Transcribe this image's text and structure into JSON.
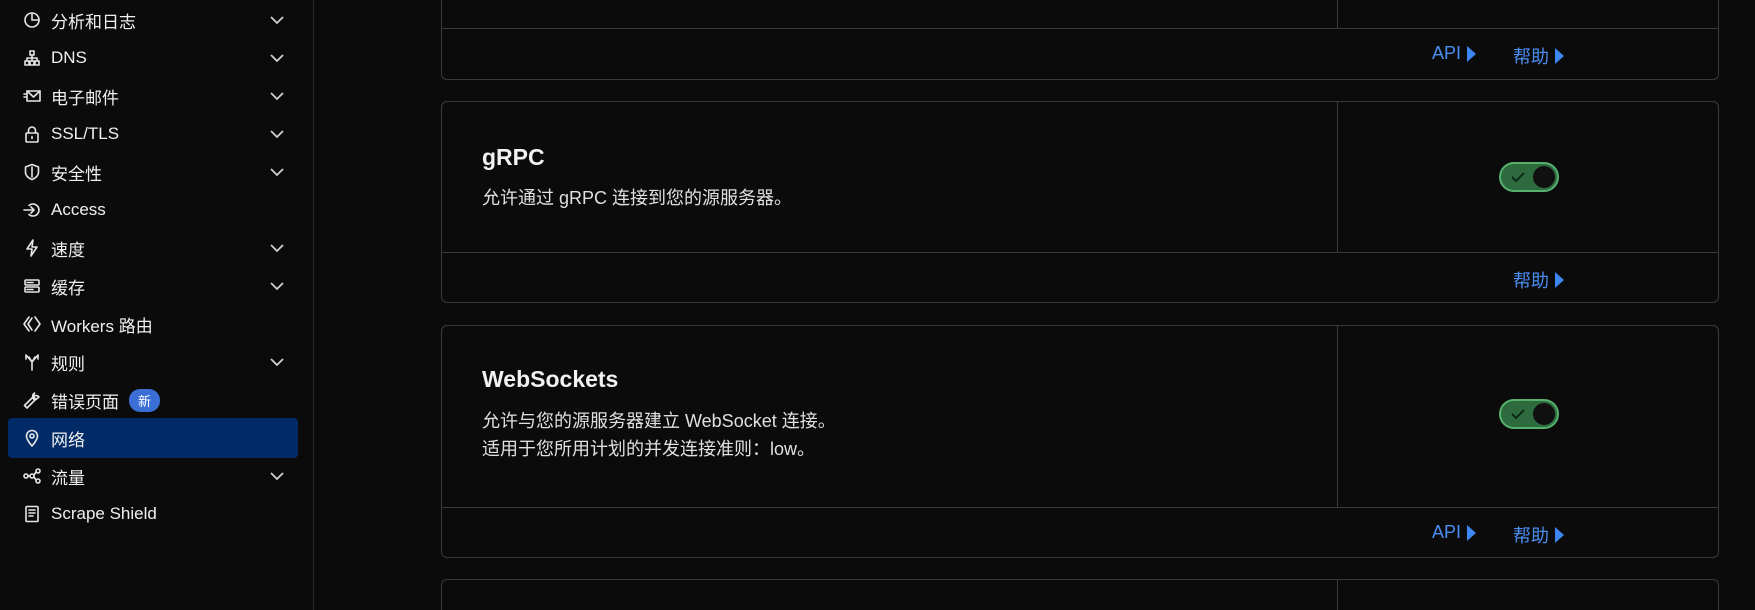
{
  "sidebar": {
    "items": [
      {
        "label": "分析和日志",
        "icon": "chart-pie-icon"
      },
      {
        "label": "DNS",
        "icon": "sitemap-icon"
      },
      {
        "label": "电子邮件",
        "icon": "email-icon"
      },
      {
        "label": "SSL/TLS",
        "icon": "lock-icon"
      },
      {
        "label": "安全性",
        "icon": "shield-icon"
      },
      {
        "label": "Access",
        "icon": "access-icon"
      },
      {
        "label": "速度",
        "icon": "bolt-icon"
      },
      {
        "label": "缓存",
        "icon": "cache-icon"
      },
      {
        "label": "Workers 路由",
        "icon": "workers-icon"
      },
      {
        "label": "规则",
        "icon": "rules-icon"
      },
      {
        "label": "错误页面",
        "icon": "wrench-icon",
        "badge": "新"
      },
      {
        "label": "网络",
        "icon": "location-pin-icon",
        "active": true
      },
      {
        "label": "流量",
        "icon": "traffic-icon"
      },
      {
        "label": "Scrape Shield",
        "icon": "document-icon"
      }
    ]
  },
  "cards": {
    "top": {
      "api": "API",
      "help": "帮助"
    },
    "grpc": {
      "title": "gRPC",
      "desc": "允许通过 gRPC 连接到您的源服务器。",
      "enabled": true,
      "help": "帮助"
    },
    "websockets": {
      "title": "WebSockets",
      "desc1": "允许与您的源服务器建立 WebSocket 连接。",
      "desc2": "适用于您所用计划的并发连接准则：low。",
      "enabled": true,
      "api": "API",
      "help": "帮助"
    }
  },
  "colors": {
    "accent_link": "#4a8ef0",
    "active_nav_bg": "#002b66",
    "toggle_on": "#2d6b3f",
    "badge_bg": "#3b6fd6"
  }
}
